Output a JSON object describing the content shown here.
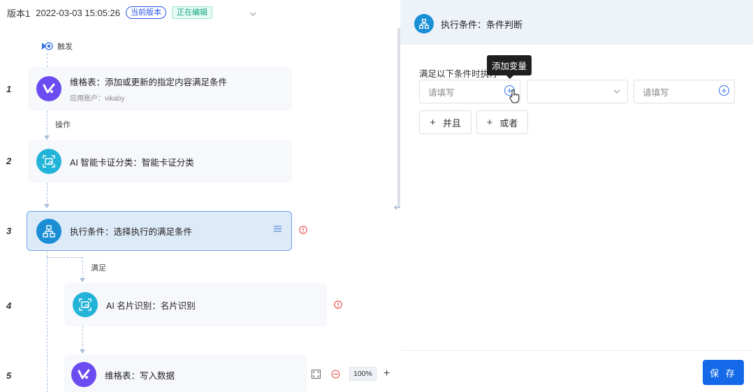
{
  "version": {
    "name": "版本1",
    "datetime": "2022-03-03 15:05:26",
    "current_badge": "当前版本",
    "editing_badge": "正在编辑"
  },
  "trigger": {
    "label": "触发"
  },
  "steps": [
    {
      "num": "1",
      "title": "维格表：添加或更新的指定内容满足条件",
      "sub": "应用账户：vikaby"
    },
    {
      "num": "2",
      "title": "AI 智能卡证分类：智能卡证分类"
    },
    {
      "num": "3",
      "title": "执行条件：选择执行的满足条件"
    },
    {
      "num": "4",
      "title": "AI 名片识别：名片识别"
    },
    {
      "num": "5",
      "title": "维格表：写入数据"
    }
  ],
  "edge_labels": {
    "operation": "操作",
    "satisfied": "满足"
  },
  "zoom": {
    "value": "100%",
    "plus": "+"
  },
  "panel": {
    "title": "执行条件：条件判断",
    "condition_label": "满足以下条件时执行",
    "tooltip": "添加变量",
    "input_placeholder_1": "请填写",
    "input_placeholder_2": "请填写",
    "and_button": "并且",
    "or_button": "或者",
    "plus_glyph": "+",
    "save_button": "保 存"
  },
  "colors": {
    "primary": "#1469e8",
    "vika_purple": "#6a4cf0",
    "ai_teal": "#22b4d8",
    "condition_blue": "#1a8fd6",
    "error_red": "#e34a4a"
  }
}
